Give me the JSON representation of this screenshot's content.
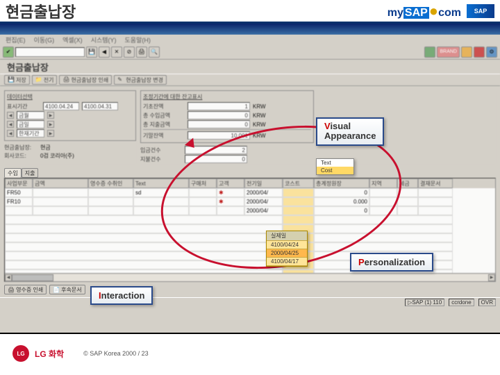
{
  "header": {
    "title": "현금출납장"
  },
  "logo": {
    "my": "my",
    "sap": "SAP",
    "com": "com",
    "box": "SAP"
  },
  "gui": {
    "menus": [
      "편집(E)",
      "이동(G)",
      "엑셀(X)",
      "시스템(Y)",
      "도움말(H)"
    ],
    "subtitle": "현금출납장",
    "apptoolbar": {
      "btns": [
        "저장",
        "전기",
        "현금출납장 인쇄",
        "현금출납장 변경"
      ]
    },
    "left_group_title": "데이터선택",
    "left_dates": {
      "row1": {
        "from": "4100.04.24",
        "to": "4100.04.31"
      },
      "labels": [
        "금월",
        "금일",
        "한재기간"
      ]
    },
    "left_meta": {
      "r1": {
        "k": "현금출납장:",
        "v": "현금"
      },
      "r2": {
        "k": "회사코드:",
        "v": "0검 코리아(주)"
      }
    },
    "right_group_title": "조정기간에 대한 잔고표시",
    "right_fields": {
      "r1": {
        "k": "기초잔액",
        "v1": "1",
        "v2": "KRW"
      },
      "r2": {
        "k": "총 수입금액",
        "v1": "0",
        "v2": "KRW"
      },
      "r3": {
        "k": "총 지출금액",
        "v1": "0",
        "v2": "KRW"
      },
      "r4": {
        "k": "기말잔액",
        "v1": "10,001",
        "v2": "KRW"
      },
      "r5": {
        "k": "입금건수",
        "v": "2"
      },
      "r6": {
        "k": "지불건수",
        "v": "0"
      }
    },
    "tab_labels": [
      "수입",
      "지출"
    ],
    "grid_headers": [
      "사업부문",
      "금액",
      "영수증 수취인",
      "Text",
      "구매처",
      "고객",
      "전기일",
      "코스트",
      "총계정원장",
      "지역",
      "세금",
      "결재문서"
    ],
    "grid_rows": [
      {
        "biz": "FR50",
        "text": "sd",
        "date": "2000/04/",
        "ledger": "0"
      },
      {
        "biz": "FR10",
        "date": "2000/04/",
        "ledger": "0.000"
      },
      {
        "date": "2000/04/",
        "ledger": "0"
      }
    ],
    "bottom_toolbar": [
      "영수증 인쇄",
      "후속문서"
    ],
    "statusbar": {
      "c1": "SAP (1) 110",
      "c2": "ccrdone",
      "c3": "OVR"
    }
  },
  "callouts": {
    "v": {
      "first": "V",
      "rest": "isual"
    },
    "a": "Appearance",
    "p": {
      "first": "P",
      "rest": "ersonalization"
    },
    "i": {
      "first": "I",
      "rest": "nteraction"
    }
  },
  "popup": {
    "items": [
      "Text",
      "Cost"
    ]
  },
  "date_popup": {
    "title": "실제일",
    "items": [
      "4100/04/24",
      "2000/04/25",
      "4100/04/17"
    ]
  },
  "footer": {
    "lg": "LG",
    "brand": "LG 화학",
    "copy": "© SAP Korea 2000 / 23"
  }
}
